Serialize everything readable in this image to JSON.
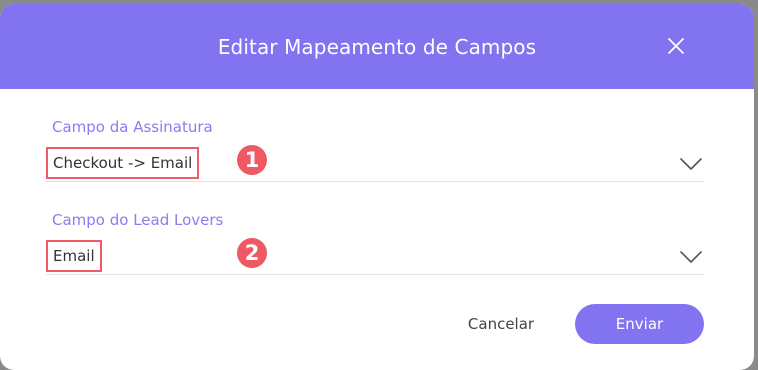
{
  "dialog": {
    "title": "Editar Mapeamento de Campos",
    "close_icon": "close-icon"
  },
  "fields": [
    {
      "label": "Campo da Assinatura",
      "value": "Checkout -> Email",
      "step": "1",
      "icon": "chevron-down-icon"
    },
    {
      "label": "Campo do Lead Lovers",
      "value": "Email",
      "step": "2",
      "icon": "chevron-down-icon"
    }
  ],
  "actions": {
    "cancel_label": "Cancelar",
    "send_label": "Enviar"
  },
  "colors": {
    "accent": "#8273f0",
    "label": "#8b7cf2",
    "highlight": "#ee5963"
  }
}
